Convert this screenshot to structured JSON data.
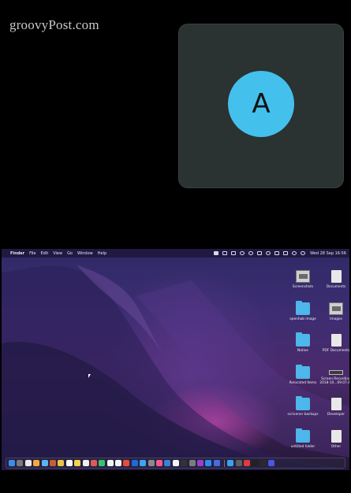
{
  "watermark": "groovyPost.com",
  "panel": {
    "avatar_letter": "A"
  },
  "menubar": {
    "apple": "",
    "app_name": "Finder",
    "menus": [
      "File",
      "Edit",
      "View",
      "Go",
      "Window",
      "Help"
    ],
    "clock": "Wed 28 Sep  16:56"
  },
  "desktop_icons": [
    {
      "label": "Screenshots",
      "kind": "shot"
    },
    {
      "label": "Documents",
      "kind": "doc"
    },
    {
      "label": "openhab image",
      "kind": "folder"
    },
    {
      "label": "Images",
      "kind": "shot"
    },
    {
      "label": "Native",
      "kind": "folder"
    },
    {
      "label": "PDF Documents",
      "kind": "doc"
    },
    {
      "label": "Relocated Items",
      "kind": "folder"
    },
    {
      "label": "Screen Recording 2018-10...09.07.47",
      "kind": "rec"
    },
    {
      "label": "scrivener backups",
      "kind": "folder"
    },
    {
      "label": "Developer",
      "kind": "doc"
    },
    {
      "label": "untitled folder",
      "kind": "folder"
    },
    {
      "label": "Other",
      "kind": "doc"
    }
  ],
  "dock_colors": [
    "#3b8ee8",
    "#7a7a7a",
    "#e8e8e8",
    "#f2a93b",
    "#59b7f0",
    "#c65d3b",
    "#e6c54a",
    "#f6f6f6",
    "#f3d34a",
    "#f0f0f0",
    "#e05a5a",
    "#3ac36b",
    "#f2f2f2",
    "#f4f4f4",
    "#e84c3d",
    "#1c6bd8",
    "#3ea3f3",
    "#8a8a8a",
    "#f35a8a",
    "#3f7fd7",
    "#f4f4f4",
    "#333333",
    "#7c7c7c",
    "#9a3fd0",
    "#2d8cf0",
    "#4a6be0",
    "#3aa0f2",
    "#5e5e5e",
    "#e23a3a",
    "#222222",
    "#2a2a2a",
    "#4b56e6"
  ]
}
